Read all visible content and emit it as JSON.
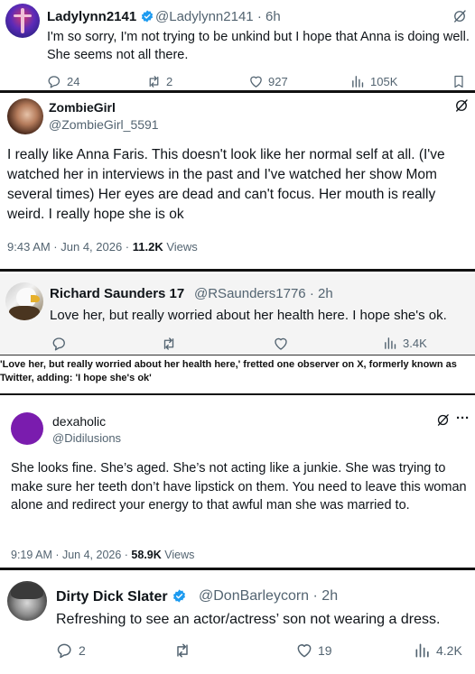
{
  "tweet1": {
    "name": "Ladylynn2141",
    "handle": "@Ladylynn2141",
    "time": "· 6h",
    "text": "I'm so sorry, I'm not trying to be unkind but I hope that Anna is doing well. She seems not all there.",
    "replies": "24",
    "retweets": "2",
    "likes": "927",
    "views": "105K"
  },
  "tweet2": {
    "name": "ZombieGirl",
    "handle": "@ZombieGirl_5591",
    "text": "I really like Anna Faris. This doesn't look like her normal self at all. (I've watched her in interviews in the past and I've watched her show Mom several times) Her eyes are dead and can't focus. Her mouth is really weird. I really hope she is ok",
    "time": "9:43 AM · Jun 4, 2026 · ",
    "views_count": "11.2K",
    "views_label": " Views"
  },
  "tweet3": {
    "name": "Richard Saunders 17",
    "handle": "@RSaunders1776",
    "time": "· 2h",
    "text": "Love her, but really worried about her health here. I hope she's ok.",
    "views": "3.4K"
  },
  "caption": "'Love her, but really worried about her health here,' fretted one observer on X, formerly known as Twitter, adding: 'I hope she's ok'",
  "tweet4": {
    "name": "dexaholic",
    "handle": "@Didilusions",
    "more": "···",
    "text": "She looks fine. She’s aged. She’s not acting like a junkie. She was trying to make sure her teeth don’t have lipstick on them. You need to leave this woman alone and redirect your energy to that awful man she was married to.",
    "time": "9:19 AM · Jun 4, 2026 · ",
    "views_count": "58.9K",
    "views_label": " Views"
  },
  "tweet5": {
    "name": "Dirty Dick Slater",
    "handle": "@DonBarleycorn",
    "time": "· 2h",
    "text": "Refreshing to see an actor/actress’ son not wearing a dress.",
    "replies": "2",
    "likes": "19",
    "views": "4.2K"
  },
  "colors": {
    "verified": "#1d9bf0",
    "muted": "#536471",
    "text": "#0f1419"
  }
}
